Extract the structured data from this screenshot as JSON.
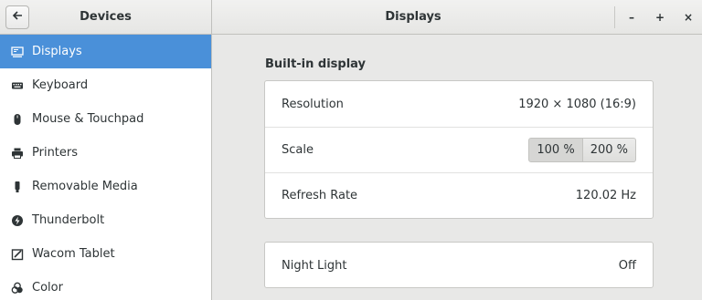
{
  "header": {
    "sidebar_title": "Devices",
    "main_title": "Displays",
    "back_icon": "back-arrow-icon",
    "minimize_label": "–",
    "maximize_label": "+",
    "close_label": "×"
  },
  "sidebar": {
    "items": [
      {
        "label": "Displays",
        "icon": "display-icon",
        "selected": true
      },
      {
        "label": "Keyboard",
        "icon": "keyboard-icon"
      },
      {
        "label": "Mouse & Touchpad",
        "icon": "mouse-icon"
      },
      {
        "label": "Printers",
        "icon": "printer-icon"
      },
      {
        "label": "Removable Media",
        "icon": "usb-drive-icon"
      },
      {
        "label": "Thunderbolt",
        "icon": "thunderbolt-icon"
      },
      {
        "label": "Wacom Tablet",
        "icon": "tablet-icon"
      },
      {
        "label": "Color",
        "icon": "color-icon"
      }
    ]
  },
  "main": {
    "section_title": "Built-in display",
    "display_rows": {
      "resolution_label": "Resolution",
      "resolution_value": "1920 × 1080 (16:9)",
      "scale_label": "Scale",
      "scale_options": [
        "100 %",
        "200 %"
      ],
      "scale_selected": "100 %",
      "refresh_label": "Refresh Rate",
      "refresh_value": "120.02 Hz"
    },
    "night_light": {
      "label": "Night Light",
      "value": "Off"
    }
  },
  "colors": {
    "selection": "#4a90d9",
    "background": "#e8e8e7",
    "sidebar_bg": "#ffffff"
  }
}
